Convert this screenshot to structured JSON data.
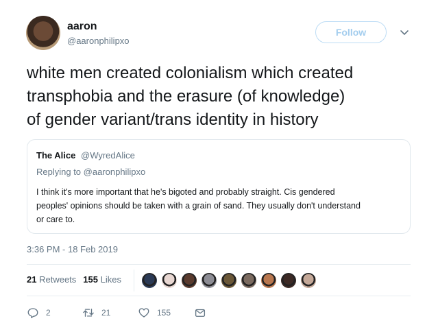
{
  "author": {
    "name": "aaron",
    "handle": "@aaronphilipxo"
  },
  "follow_label": "Follow",
  "text_lines": [
    "white men created colonialism which created",
    "transphobia and the erasure (of knowledge)",
    "of gender variant/trans identity in history"
  ],
  "quote": {
    "name": "The Alice",
    "handle": "@WyredAlice",
    "replying_prefix": "Replying to ",
    "replying_to": "@aaronphilipxo",
    "text_lines": [
      "I think it's more important that he's bigoted and probably straight. Cis gendered",
      "peoples' opinions should be taken with a grain of sand. They usually don't understand",
      "or care to."
    ]
  },
  "timestamp": "3:36 PM - 18 Feb 2019",
  "stats": {
    "retweets_count": "21",
    "retweets_label": "Retweets",
    "likes_count": "155",
    "likes_label": "Likes"
  },
  "liker_avatar_colors": [
    "#2b3a55",
    "#e8d7d2",
    "#5a3b2e",
    "#8d8d95",
    "#6b5838",
    "#7b6b60",
    "#b9774f",
    "#3c2a25",
    "#c4a898"
  ],
  "actions": {
    "reply_count": "2",
    "retweet_count": "21",
    "like_count": "155"
  },
  "colors": {
    "follow_border": "#bcdcf5",
    "follow_text": "#a3cdee",
    "secondary_text": "#657786",
    "divider": "#e6ecf0"
  },
  "icons": [
    "chevron-down-icon",
    "reply-icon",
    "retweet-icon",
    "like-icon",
    "message-icon"
  ]
}
